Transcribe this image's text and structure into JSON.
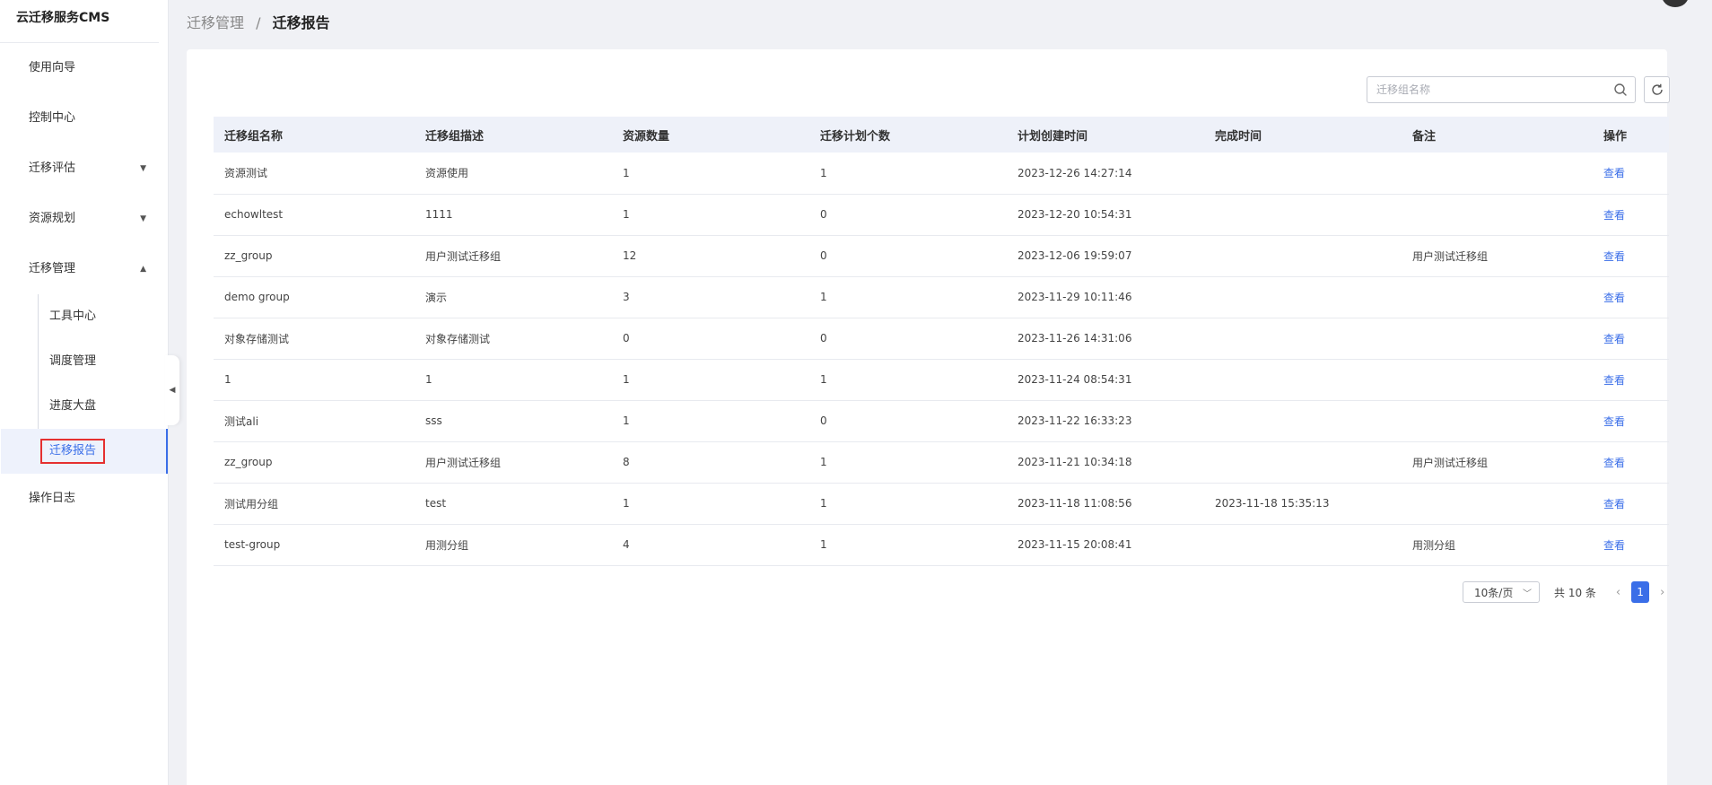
{
  "sidebar": {
    "brand": "云迁移服务CMS",
    "items": [
      {
        "label": "使用向导"
      },
      {
        "label": "控制中心"
      },
      {
        "label": "迁移评估"
      },
      {
        "label": "资源规划"
      },
      {
        "label": "迁移管理"
      }
    ],
    "subitems": [
      {
        "label": "工具中心"
      },
      {
        "label": "调度管理"
      },
      {
        "label": "进度大盘"
      },
      {
        "label": "迁移报告"
      }
    ],
    "footer_item": {
      "label": "操作日志"
    }
  },
  "header": {
    "breadcrumb_parent": "迁移管理",
    "breadcrumb_sep": "/",
    "breadcrumb_current": "迁移报告"
  },
  "search": {
    "placeholder": "迁移组名称"
  },
  "table": {
    "columns": [
      "迁移组名称",
      "迁移组描述",
      "资源数量",
      "迁移计划个数",
      "计划创建时间",
      "完成时间",
      "备注",
      "操作"
    ],
    "rows": [
      [
        "资源测试",
        "资源使用",
        "1",
        "1",
        "2023-12-26 14:27:14",
        "",
        "",
        "查看"
      ],
      [
        "echowltest",
        "1111",
        "1",
        "0",
        "2023-12-20 10:54:31",
        "",
        "",
        "查看"
      ],
      [
        "zz_group",
        "用户测试迁移组",
        "12",
        "0",
        "2023-12-06 19:59:07",
        "",
        "用户测试迁移组",
        "查看"
      ],
      [
        "demo group",
        "演示",
        "3",
        "1",
        "2023-11-29 10:11:46",
        "",
        "",
        "查看"
      ],
      [
        "对象存储测试",
        "对象存储测试",
        "0",
        "0",
        "2023-11-26 14:31:06",
        "",
        "",
        "查看"
      ],
      [
        "1",
        "1",
        "1",
        "1",
        "2023-11-24 08:54:31",
        "",
        "",
        "查看"
      ],
      [
        "测试ali",
        "sss",
        "1",
        "0",
        "2023-11-22 16:33:23",
        "",
        "",
        "查看"
      ],
      [
        "zz_group",
        "用户测试迁移组",
        "8",
        "1",
        "2023-11-21 10:34:18",
        "",
        "用户测试迁移组",
        "查看"
      ],
      [
        "测试用分组",
        "test",
        "1",
        "1",
        "2023-11-18 11:08:56",
        "2023-11-18 15:35:13",
        "",
        "查看"
      ],
      [
        "test-group",
        "用测分组",
        "4",
        "1",
        "2023-11-15 20:08:41",
        "",
        "用测分组",
        "查看"
      ]
    ]
  },
  "pagination": {
    "page_size": "10条/页",
    "total": "共 10 条",
    "current_page": "1",
    "prev": "‹",
    "next": "›"
  },
  "colors": {
    "accent": "#3a6ee8",
    "highlight_border": "#e53030"
  }
}
